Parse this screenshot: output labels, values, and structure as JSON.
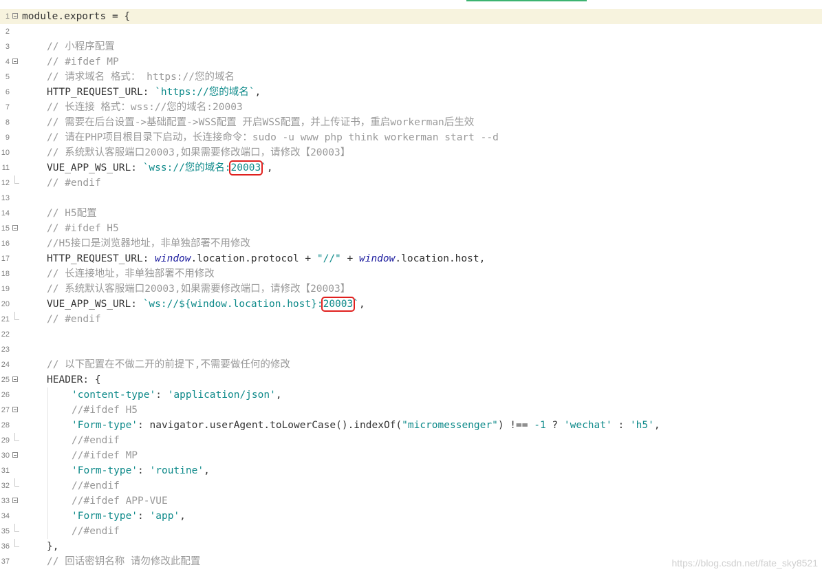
{
  "watermark": "https://blog.csdn.net/fate_sky8521",
  "lines": [
    {
      "n": "1",
      "fold": true,
      "indent": 0,
      "current": true,
      "tokens": [
        {
          "t": "module.exports = {",
          "c": "o"
        }
      ]
    },
    {
      "n": "2",
      "indent": 0,
      "tokens": []
    },
    {
      "n": "3",
      "indent": 1,
      "tokens": [
        {
          "t": "// 小程序配置",
          "c": "c"
        }
      ]
    },
    {
      "n": "4",
      "fold": true,
      "indent": 1,
      "tokens": [
        {
          "t": "// #ifdef MP",
          "c": "c"
        }
      ]
    },
    {
      "n": "5",
      "indent": 1,
      "tokens": [
        {
          "t": "// 请求域名 格式： https://您的域名",
          "c": "c"
        }
      ]
    },
    {
      "n": "6",
      "indent": 1,
      "tokens": [
        {
          "t": "HTTP_REQUEST_URL: ",
          "c": "o"
        },
        {
          "t": "`https://您的域名`",
          "c": "s"
        },
        {
          "t": ",",
          "c": "o"
        }
      ]
    },
    {
      "n": "7",
      "indent": 1,
      "tokens": [
        {
          "t": "// 长连接 格式：wss://您的域名:20003",
          "c": "c"
        }
      ]
    },
    {
      "n": "8",
      "indent": 1,
      "tokens": [
        {
          "t": "// 需要在后台设置->基础配置->WSS配置 开启WSS配置，并上传证书，重启workerman后生效",
          "c": "c"
        }
      ]
    },
    {
      "n": "9",
      "indent": 1,
      "tokens": [
        {
          "t": "// 请在PHP项目根目录下启动，长连接命令：sudo -u www php think workerman start --d",
          "c": "c"
        }
      ]
    },
    {
      "n": "10",
      "indent": 1,
      "tokens": [
        {
          "t": "// 系统默认客服端口20003,如果需要修改端口，请修改【20003】",
          "c": "c"
        }
      ]
    },
    {
      "n": "11",
      "indent": 1,
      "tokens": [
        {
          "t": "VUE_APP_WS_URL: ",
          "c": "o"
        },
        {
          "t": "`wss://您的域名:",
          "c": "s"
        },
        {
          "t": "20003",
          "c": "s",
          "hl": true
        },
        {
          "t": "`",
          "c": "s"
        },
        {
          "t": ",",
          "c": "o"
        }
      ]
    },
    {
      "n": "12",
      "tail": true,
      "indent": 1,
      "tokens": [
        {
          "t": "// #endif",
          "c": "c"
        }
      ]
    },
    {
      "n": "13",
      "indent": 0,
      "tokens": []
    },
    {
      "n": "14",
      "indent": 1,
      "tokens": [
        {
          "t": "// H5配置",
          "c": "c"
        }
      ]
    },
    {
      "n": "15",
      "fold": true,
      "indent": 1,
      "tokens": [
        {
          "t": "// #ifdef H5",
          "c": "c"
        }
      ]
    },
    {
      "n": "16",
      "indent": 1,
      "tokens": [
        {
          "t": "//H5接口是浏览器地址，非单独部署不用修改",
          "c": "c"
        }
      ]
    },
    {
      "n": "17",
      "indent": 1,
      "tokens": [
        {
          "t": "HTTP_REQUEST_URL: ",
          "c": "o"
        },
        {
          "t": "window",
          "c": "k"
        },
        {
          "t": ".location.protocol + ",
          "c": "o"
        },
        {
          "t": "\"//\"",
          "c": "s"
        },
        {
          "t": " + ",
          "c": "o"
        },
        {
          "t": "window",
          "c": "k"
        },
        {
          "t": ".location.host,",
          "c": "o"
        }
      ]
    },
    {
      "n": "18",
      "indent": 1,
      "tokens": [
        {
          "t": "// 长连接地址，非单独部署不用修改",
          "c": "c"
        }
      ]
    },
    {
      "n": "19",
      "indent": 1,
      "tokens": [
        {
          "t": "// 系统默认客服端口20003,如果需要修改端口，请修改【20003】",
          "c": "c"
        }
      ]
    },
    {
      "n": "20",
      "indent": 1,
      "tokens": [
        {
          "t": "VUE_APP_WS_URL: ",
          "c": "o"
        },
        {
          "t": "`ws://${window.location.host}:",
          "c": "s"
        },
        {
          "t": "20003",
          "c": "s",
          "hl": true
        },
        {
          "t": "`",
          "c": "s"
        },
        {
          "t": ",",
          "c": "o"
        }
      ]
    },
    {
      "n": "21",
      "tail": true,
      "indent": 1,
      "tokens": [
        {
          "t": "// #endif",
          "c": "c"
        }
      ]
    },
    {
      "n": "22",
      "indent": 0,
      "tokens": []
    },
    {
      "n": "23",
      "indent": 0,
      "tokens": []
    },
    {
      "n": "24",
      "indent": 1,
      "tokens": [
        {
          "t": "// 以下配置在不做二开的前提下,不需要做任何的修改",
          "c": "c"
        }
      ]
    },
    {
      "n": "25",
      "fold": true,
      "indent": 1,
      "tokens": [
        {
          "t": "HEADER: {",
          "c": "o"
        }
      ]
    },
    {
      "n": "26",
      "indent": 2,
      "tokens": [
        {
          "t": "'content-type'",
          "c": "s"
        },
        {
          "t": ": ",
          "c": "o"
        },
        {
          "t": "'application/json'",
          "c": "s"
        },
        {
          "t": ",",
          "c": "o"
        }
      ]
    },
    {
      "n": "27",
      "fold": true,
      "indent": 2,
      "tokens": [
        {
          "t": "//#ifdef H5",
          "c": "c"
        }
      ]
    },
    {
      "n": "28",
      "indent": 2,
      "tokens": [
        {
          "t": "'Form-type'",
          "c": "s"
        },
        {
          "t": ": navigator.userAgent.toLowerCase().indexOf(",
          "c": "o"
        },
        {
          "t": "\"micromessenger\"",
          "c": "s"
        },
        {
          "t": ") !== ",
          "c": "o"
        },
        {
          "t": "-1",
          "c": "s"
        },
        {
          "t": " ? ",
          "c": "o"
        },
        {
          "t": "'wechat'",
          "c": "s"
        },
        {
          "t": " : ",
          "c": "o"
        },
        {
          "t": "'h5'",
          "c": "s"
        },
        {
          "t": ",",
          "c": "o"
        }
      ]
    },
    {
      "n": "29",
      "tail": true,
      "indent": 2,
      "tokens": [
        {
          "t": "//#endif",
          "c": "c"
        }
      ]
    },
    {
      "n": "30",
      "fold": true,
      "indent": 2,
      "tokens": [
        {
          "t": "//#ifdef MP",
          "c": "c"
        }
      ]
    },
    {
      "n": "31",
      "indent": 2,
      "tokens": [
        {
          "t": "'Form-type'",
          "c": "s"
        },
        {
          "t": ": ",
          "c": "o"
        },
        {
          "t": "'routine'",
          "c": "s"
        },
        {
          "t": ",",
          "c": "o"
        }
      ]
    },
    {
      "n": "32",
      "tail": true,
      "indent": 2,
      "tokens": [
        {
          "t": "//#endif",
          "c": "c"
        }
      ]
    },
    {
      "n": "33",
      "fold": true,
      "indent": 2,
      "tokens": [
        {
          "t": "//#ifdef APP-VUE",
          "c": "c"
        }
      ]
    },
    {
      "n": "34",
      "indent": 2,
      "tokens": [
        {
          "t": "'Form-type'",
          "c": "s"
        },
        {
          "t": ": ",
          "c": "o"
        },
        {
          "t": "'app'",
          "c": "s"
        },
        {
          "t": ",",
          "c": "o"
        }
      ]
    },
    {
      "n": "35",
      "tail": true,
      "indent": 2,
      "tokens": [
        {
          "t": "//#endif",
          "c": "c"
        }
      ]
    },
    {
      "n": "36",
      "tail": true,
      "indent": 1,
      "tokens": [
        {
          "t": "},",
          "c": "o"
        }
      ]
    },
    {
      "n": "37",
      "indent": 1,
      "tokens": [
        {
          "t": "// 回话密钥名称 请勿修改此配置",
          "c": "c"
        }
      ]
    }
  ]
}
